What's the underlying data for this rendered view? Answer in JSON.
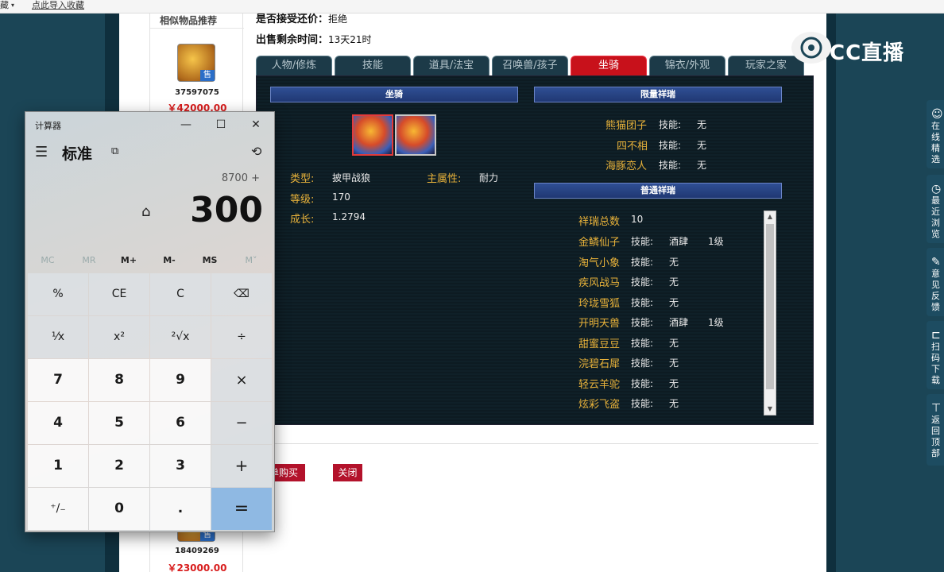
{
  "topbar": {
    "left_label": "藏",
    "bookmark": "点此导入收藏"
  },
  "list": {
    "title": "相似物品推荐",
    "items": [
      {
        "id": "37597075",
        "price": "￥42000.00",
        "badge": "售"
      },
      {
        "id": "18409269",
        "price": "￥23000.00",
        "badge": "售"
      }
    ]
  },
  "info": {
    "bargain_label": "是否接受还价：",
    "bargain_value": "拒绝",
    "time_label": "出售剩余时间：",
    "time_value": "13天21时"
  },
  "tabs": [
    {
      "label": "人物/修炼"
    },
    {
      "label": "技能"
    },
    {
      "label": "道具/法宝"
    },
    {
      "label": "召唤兽/孩子"
    },
    {
      "label": "坐骑"
    },
    {
      "label": "锦衣/外观"
    },
    {
      "label": "玩家之家"
    }
  ],
  "active_tab": "坐骑",
  "mount": {
    "header": "坐骑",
    "type_label": "类型:",
    "type_value": "披甲战狼",
    "attr_label": "主属性:",
    "attr_value": "耐力",
    "level_label": "等级:",
    "level_value": "170",
    "growth_label": "成长:",
    "growth_value": "1.2794"
  },
  "rare": {
    "header": "限量祥瑞",
    "items": [
      {
        "name": "熊猫团子",
        "skill_label": "技能:",
        "skill": "无"
      },
      {
        "name": "四不相",
        "skill_label": "技能:",
        "skill": "无"
      },
      {
        "name": "海豚恋人",
        "skill_label": "技能:",
        "skill": "无"
      }
    ]
  },
  "normal": {
    "header": "普通祥瑞",
    "total_label": "祥瑞总数",
    "total_value": "10",
    "items": [
      {
        "name": "金鳞仙子",
        "skill_label": "技能:",
        "skill": "酒肆",
        "level": "1级"
      },
      {
        "name": "淘气小象",
        "skill_label": "技能:",
        "skill": "无",
        "level": ""
      },
      {
        "name": "疾风战马",
        "skill_label": "技能:",
        "skill": "无",
        "level": ""
      },
      {
        "name": "玲珑雪狐",
        "skill_label": "技能:",
        "skill": "无",
        "level": ""
      },
      {
        "name": "开明天兽",
        "skill_label": "技能:",
        "skill": "酒肆",
        "level": "1级"
      },
      {
        "name": "甜蜜豆豆",
        "skill_label": "技能:",
        "skill": "无",
        "level": ""
      },
      {
        "name": "浣碧石犀",
        "skill_label": "技能:",
        "skill": "无",
        "level": ""
      },
      {
        "name": "轻云羊驼",
        "skill_label": "技能:",
        "skill": "无",
        "level": ""
      },
      {
        "name": "炫彩飞盗",
        "skill_label": "技能:",
        "skill": "无",
        "level": ""
      }
    ]
  },
  "actions": {
    "buy": "单购买",
    "close": "关闭"
  },
  "watermark": {
    "brand": "CC直播"
  },
  "right_sidebar": [
    {
      "icon": "user-icon",
      "text": "在线精选"
    },
    {
      "icon": "clock-icon",
      "text": "最近浏览"
    },
    {
      "icon": "edit-icon",
      "text": "意见反馈"
    },
    {
      "icon": "scan-icon",
      "text": "扫码下载"
    },
    {
      "icon": "top-icon",
      "text": "返回顶部"
    }
  ],
  "calculator": {
    "window_title": "计算器",
    "mode": "标准",
    "expression": "8700 +",
    "display": "300",
    "memory": [
      "MC",
      "MR",
      "M+",
      "M-",
      "MS",
      "M˅"
    ],
    "keys": [
      [
        "%",
        "CE",
        "C",
        "⌫"
      ],
      [
        "¹⁄x",
        "x²",
        "²√x",
        "÷"
      ],
      [
        "7",
        "8",
        "9",
        "×"
      ],
      [
        "4",
        "5",
        "6",
        "−"
      ],
      [
        "1",
        "2",
        "3",
        "+"
      ],
      [
        "⁺/₋",
        "0",
        ".",
        "="
      ]
    ]
  }
}
